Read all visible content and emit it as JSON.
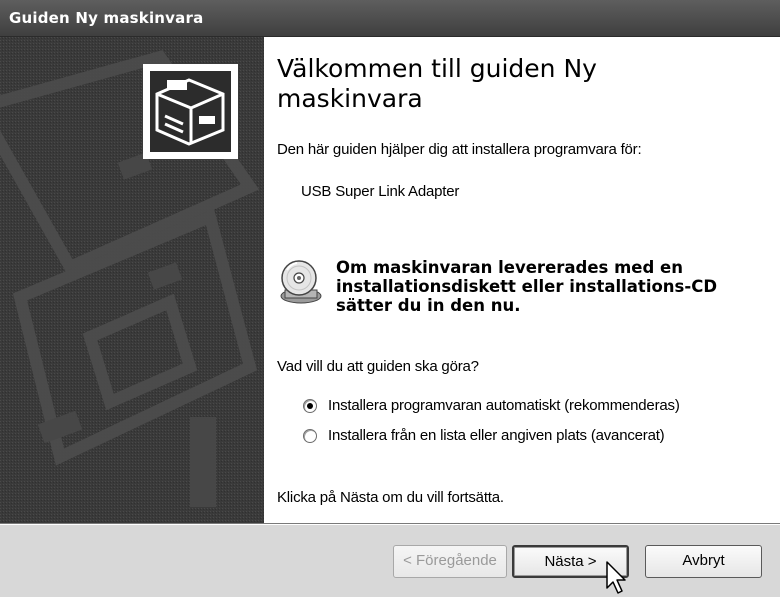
{
  "window": {
    "title": "Guiden Ny maskinvara"
  },
  "main": {
    "heading": "Välkommen till guiden Ny maskinvara",
    "intro": "Den här guiden hjälper dig att installera programvara för:",
    "device": "USB Super Link Adapter",
    "notice": "Om maskinvaran levererades med en installationsdiskett eller installations-CD sätter du in den nu.",
    "question": "Vad vill du att guiden ska göra?",
    "options": [
      {
        "label": "Installera programvaran automatiskt (rekommenderas)",
        "selected": true
      },
      {
        "label": "Installera från en lista eller angiven plats (avancerat)",
        "selected": false
      }
    ],
    "footnote": "Klicka på Nästa om du vill fortsätta."
  },
  "footer": {
    "back_label": "< Föregående",
    "next_label": "Nästa >",
    "cancel_label": "Avbryt"
  },
  "icons": [
    "hardware-wizard-icon",
    "cd-icon",
    "mouse-pointer-icon"
  ]
}
